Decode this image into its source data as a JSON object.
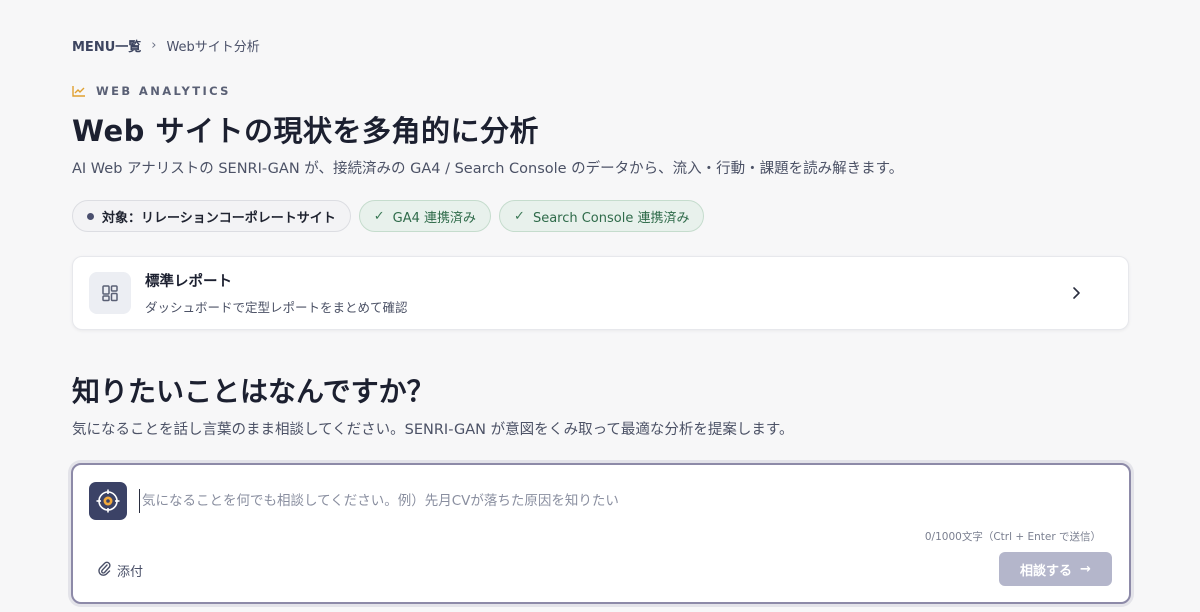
{
  "breadcrumb": {
    "root": "MENU一覧",
    "separator": "›",
    "current": "Webサイト分析"
  },
  "eyebrow": {
    "icon": "chart-line-icon",
    "label": "WEB ANALYTICS",
    "accent": "#e0a030"
  },
  "header": {
    "title": "Web サイトの現状を多角的に分析",
    "subtitle": "AI Web アナリストの SENRI-GAN が、接続済みの GA4 / Search Console のデータから、流入・行動・課題を読み解きます。"
  },
  "chips": {
    "target": "対象：リレーションコーポレートサイト",
    "ga4": "GA4 連携済み",
    "search_console": "Search Console 連携済み",
    "check_icon": "✓"
  },
  "report_card": {
    "icon": "grid-icon",
    "title": "標準レポート",
    "description": "ダッシュボードで定型レポートをまとめて確認"
  },
  "ask": {
    "heading": "知りたいことはなんですか？",
    "description": "気になることを話し言葉のまま相談してください。SENRI-GAN が意図をくみ取って最適な分析を提案します。"
  },
  "composer": {
    "avatar_icon": "target-icon",
    "placeholder": "気になることを何でも相談してください。例）先月CVが落ちた原因を知りたい",
    "value": "",
    "counter": "0/1000文字（Ctrl + Enter で送信）",
    "attach_label": "添付",
    "submit_label": "相談する",
    "submit_arrow": "→"
  },
  "colors": {
    "background": "#f7f7f8",
    "brand_navy": "#3b4266",
    "success_green": "#2f6b4a",
    "submit_disabled": "#b4b6cb"
  }
}
